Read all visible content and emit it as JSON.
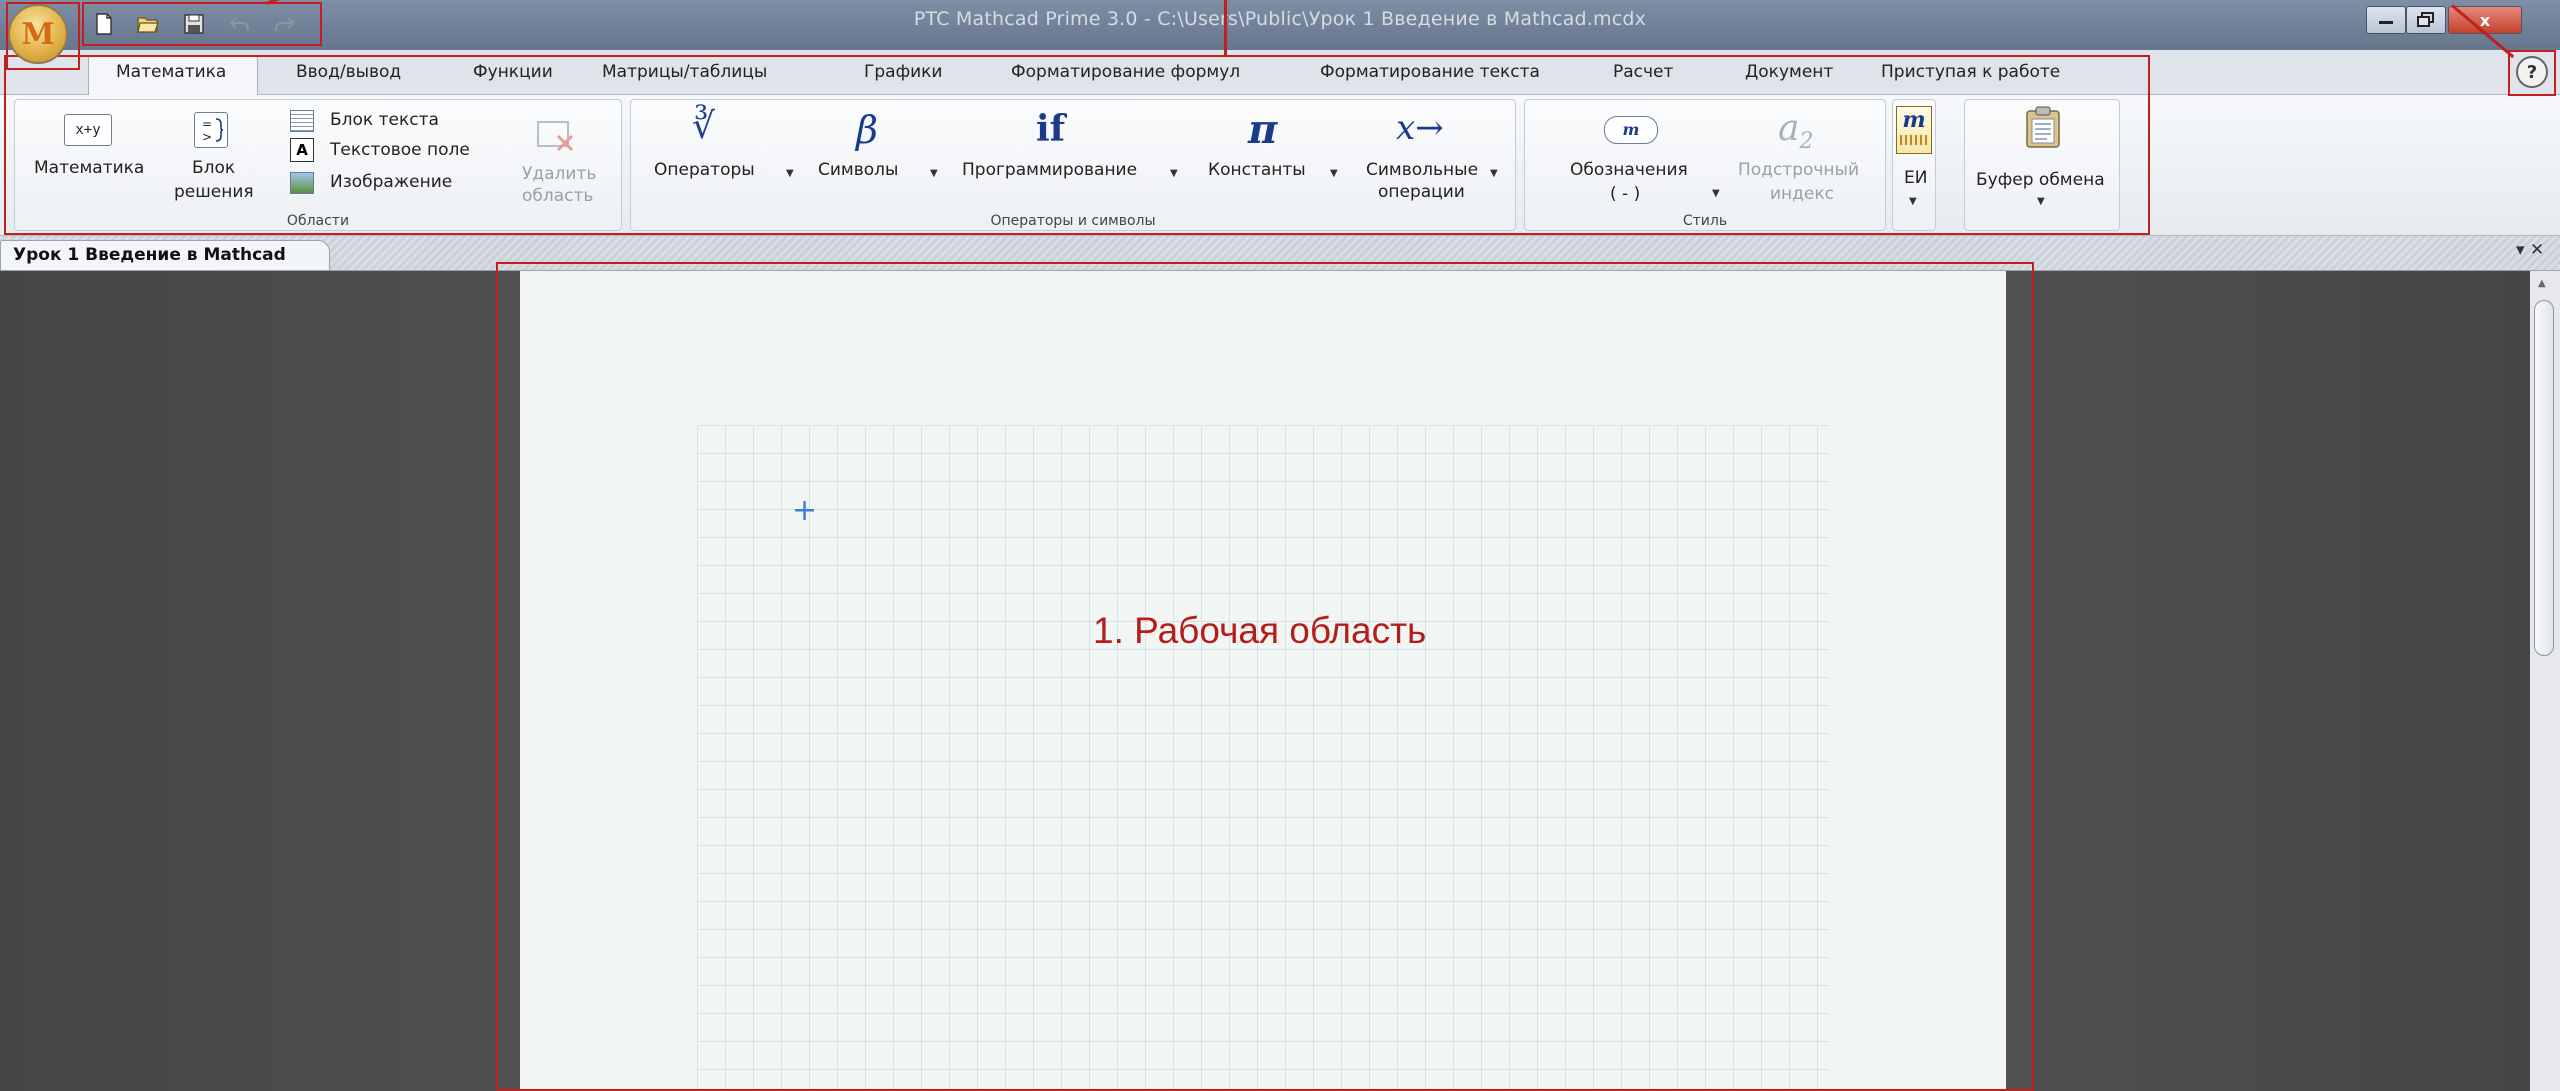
{
  "window": {
    "title": "PTC Mathcad Prime 3.0 - C:\\Users\\Public\\Урок 1 Введение в Mathcad.mcdx",
    "close_glyph": "x"
  },
  "app_button": {
    "letter": "M"
  },
  "tabs": [
    "Математика",
    "Ввод/вывод",
    "Функции",
    "Матрицы/таблицы",
    "Графики",
    "Форматирование формул",
    "Форматирование текста",
    "Расчет",
    "Документ",
    "Приступая к работе"
  ],
  "help": "?",
  "ribbon": {
    "regions": {
      "label": "Области",
      "math_icon": "x+y",
      "math": "Математика",
      "block_line1": "Блок",
      "block_line2": "решения",
      "text_block": "Блок текста",
      "text_field": "Текстовое поле",
      "text_field_icon": "A",
      "image": "Изображение",
      "delete_line1": "Удалить",
      "delete_line2": "область"
    },
    "operators": {
      "label": "Операторы и символы",
      "operators_icon": "∛",
      "operators": "Операторы",
      "symbols_icon": "β",
      "symbols": "Символы",
      "programming_icon": "if",
      "programming": "Программирование",
      "constants_icon": "π",
      "constants": "Константы",
      "symbolic_icon": "x→",
      "symbolic_line1": "Символьные",
      "symbolic_line2": "операции"
    },
    "style": {
      "label": "Стиль",
      "labels_line1": "Обозначения",
      "labels_line2": "( - )",
      "subscript_icon": "a",
      "subscript_icon_sub": "2",
      "subscript_line1": "Подстрочный",
      "subscript_line2": "индекс"
    },
    "units": {
      "icon": "m",
      "label": "ЕИ"
    },
    "clipboard": {
      "label": "Буфер обмена"
    }
  },
  "document": {
    "tab": "Урок 1 Введение в Mathcad",
    "pane_controls": "▾ ✕"
  },
  "workspace": {
    "annotation": "1. Рабочая область"
  }
}
